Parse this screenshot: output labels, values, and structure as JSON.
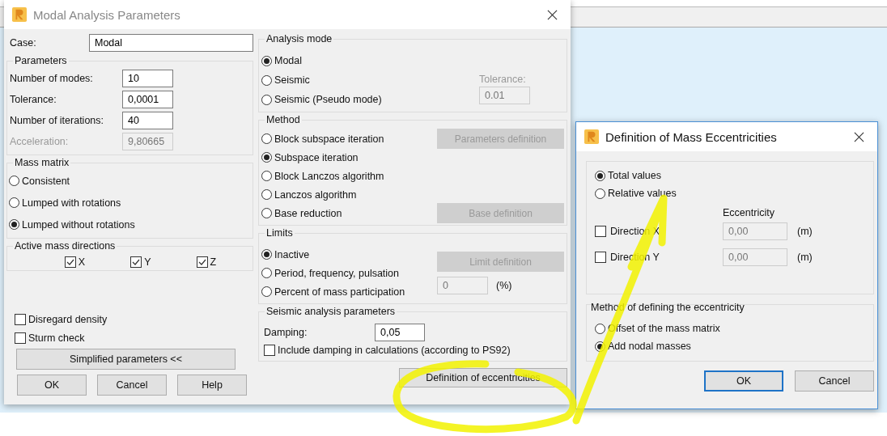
{
  "main_dialog": {
    "title": "Modal Analysis Parameters",
    "case": {
      "label": "Case:",
      "value": "Modal"
    },
    "parameters": {
      "title": "Parameters",
      "fields": [
        {
          "label": "Number of modes:",
          "value": "10",
          "disabled": false
        },
        {
          "label": "Tolerance:",
          "value": "0,0001",
          "disabled": false
        },
        {
          "label": "Number of iterations:",
          "value": "40",
          "disabled": false
        },
        {
          "label": "Acceleration:",
          "value": "9,80665",
          "disabled": true
        }
      ]
    },
    "mass_matrix": {
      "title": "Mass matrix",
      "options": [
        {
          "label": "Consistent",
          "selected": false
        },
        {
          "label": "Lumped with rotations",
          "selected": false
        },
        {
          "label": "Lumped without rotations",
          "selected": true
        }
      ]
    },
    "active_mass_directions": {
      "title": "Active mass directions",
      "items": [
        {
          "label": "X",
          "checked": true
        },
        {
          "label": "Y",
          "checked": true
        },
        {
          "label": "Z",
          "checked": true
        }
      ]
    },
    "options": [
      {
        "label": "Disregard density",
        "checked": false
      },
      {
        "label": "Sturm check",
        "checked": false
      }
    ],
    "simplified_button": "Simplified parameters <<",
    "buttons": [
      "OK",
      "Cancel",
      "Help"
    ],
    "analysis_mode": {
      "title": "Analysis mode",
      "options": [
        {
          "label": "Modal",
          "selected": true
        },
        {
          "label": "Seismic",
          "selected": false
        },
        {
          "label": "Seismic (Pseudo mode)",
          "selected": false
        }
      ],
      "tolerance": {
        "label": "Tolerance:",
        "value": "0.01",
        "disabled": true
      }
    },
    "method": {
      "title": "Method",
      "options": [
        {
          "label": "Block subspace iteration",
          "selected": false,
          "side_button": {
            "label": "Parameters definition",
            "disabled": true
          }
        },
        {
          "label": "Subspace iteration",
          "selected": true
        },
        {
          "label": "Block Lanczos algorithm",
          "selected": false
        },
        {
          "label": "Lanczos algorithm",
          "selected": false
        },
        {
          "label": "Base reduction",
          "selected": false,
          "side_button": {
            "label": "Base definition",
            "disabled": true
          }
        }
      ]
    },
    "limits": {
      "title": "Limits",
      "options": [
        {
          "label": "Inactive",
          "selected": true
        },
        {
          "label": "Period, frequency, pulsation",
          "selected": false
        },
        {
          "label": "Percent of mass participation",
          "selected": false
        }
      ],
      "limit_button": {
        "label": "Limit definition",
        "disabled": true
      },
      "percent": {
        "value": "0",
        "unit": "(%)",
        "disabled": true
      }
    },
    "seismic": {
      "title": "Seismic analysis parameters",
      "damping": {
        "label": "Damping:",
        "value": "0,05"
      },
      "include": {
        "label": "Include damping in calculations (according to PS92)",
        "checked": false
      }
    },
    "eccentricities_button": "Definition of eccentricities"
  },
  "eccentricity_dialog": {
    "title": "Definition of Mass Eccentricities",
    "value_type": [
      {
        "label": "Total values",
        "selected": true
      },
      {
        "label": "Relative values",
        "selected": false
      }
    ],
    "column_heading": "Eccentricity",
    "directions": [
      {
        "label": "Direction X",
        "checked": false,
        "value": "0,00",
        "disabled": true,
        "unit": "(m)"
      },
      {
        "label": "Direction Y",
        "checked": false,
        "value": "0,00",
        "disabled": true,
        "unit": "(m)"
      }
    ],
    "method": {
      "title": "Method of defining the eccentricity",
      "options": [
        {
          "label": "Offset of the mass matrix",
          "selected": false
        },
        {
          "label": "Add nodal masses",
          "selected": true
        }
      ]
    },
    "buttons": [
      {
        "label": "OK",
        "default": true
      },
      {
        "label": "Cancel",
        "default": false
      }
    ]
  }
}
